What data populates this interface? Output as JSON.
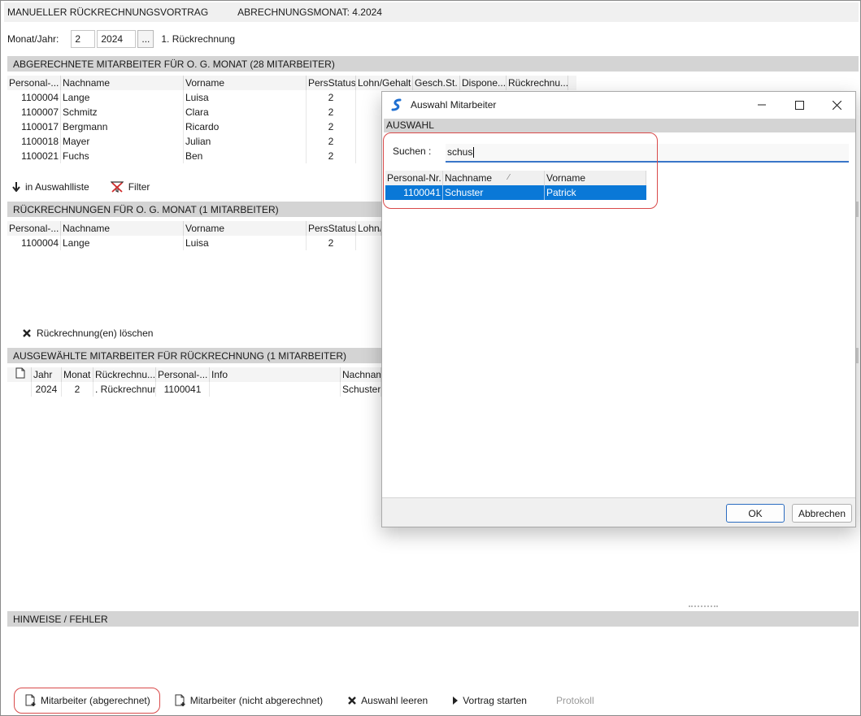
{
  "header": {
    "title": "MANUELLER RÜCKRECHNUNGSVORTRAG",
    "month_label": "ABRECHNUNGSMONAT: 4.2024"
  },
  "period": {
    "label": "Monat/Jahr:",
    "month": "2",
    "year": "2024",
    "browse_label": "...",
    "run_label": "1. Rückrechnung"
  },
  "section_billed": {
    "title": "ABGERECHNETE MITARBEITER FÜR O. G. MONAT (28 MITARBEITER)",
    "columns": [
      "Personal-...",
      "Nachname",
      "Vorname",
      "PersStatus",
      "Lohn/Gehalt",
      "Gesch.St.",
      "Dispone...",
      "Rückrechnu..."
    ],
    "rows": [
      [
        "1100004",
        "Lange",
        "Luisa",
        "2"
      ],
      [
        "1100007",
        "Schmitz",
        "Clara",
        "2"
      ],
      [
        "1100017",
        "Bergmann",
        "Ricardo",
        "2"
      ],
      [
        "1100018",
        "Mayer",
        "Julian",
        "2"
      ],
      [
        "1100021",
        "Fuchs",
        "Ben",
        "2"
      ]
    ],
    "action_add": "in Auswahlliste",
    "action_filter": "Filter"
  },
  "section_recalc": {
    "title": "RÜCKRECHNUNGEN FÜR O. G. MONAT (1 MITARBEITER)",
    "columns": [
      "Personal-...",
      "Nachname",
      "Vorname",
      "PersStatus",
      "Lohn/"
    ],
    "rows": [
      [
        "1100004",
        "Lange",
        "Luisa",
        "2"
      ]
    ],
    "action_delete": "Rückrechnung(en) löschen"
  },
  "section_selected": {
    "title": "AUSGEWÄHLTE MITARBEITER FÜR RÜCKRECHNUNG (1 MITARBEITER)",
    "columns": [
      "Jahr",
      "Monat",
      "Rückrechnu...",
      "Personal-...",
      "Info",
      "Nachnam"
    ],
    "rows": [
      [
        "2024",
        "2",
        ". Rückrechnun",
        "1100041",
        "",
        "Schuster"
      ]
    ]
  },
  "section_notes": {
    "title": "HINWEISE / FEHLER"
  },
  "bottom_actions": {
    "billed": "Mitarbeiter (abgerechnet)",
    "unbilled": "Mitarbeiter (nicht abgerechnet)",
    "clear": "Auswahl leeren",
    "start": "Vortrag starten",
    "protocol": "Protokoll"
  },
  "dialog": {
    "title": "Auswahl Mitarbeiter",
    "section": "AUSWAHL",
    "search_label": "Suchen :",
    "search_value": "schus",
    "columns": [
      "Personal-Nr.",
      "Nachname",
      "Vorname"
    ],
    "rows": [
      [
        "1100041",
        "Schuster",
        "Patrick"
      ]
    ],
    "ok": "OK",
    "cancel": "Abbrechen"
  },
  "colors": {
    "selection": "#0a78d7",
    "highlight_box": "#d94a4a",
    "section_bg": "#d4d4d4"
  }
}
